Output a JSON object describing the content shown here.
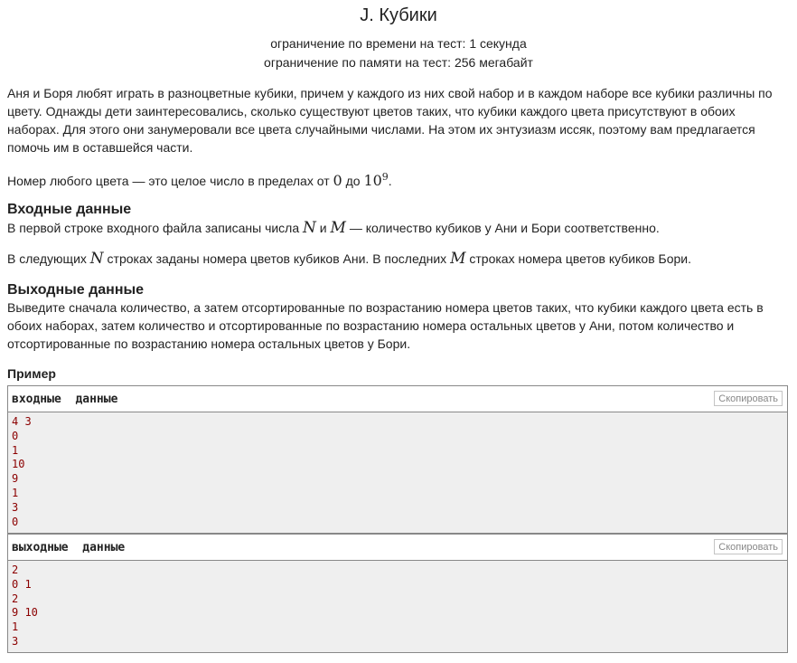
{
  "problem": {
    "title": "J. Кубики",
    "time_limit": "ограничение по времени на тест: 1 секунда",
    "memory_limit": "ограничение по памяти на тест: 256 мегабайт"
  },
  "legend": {
    "text": "Аня и Боря любят играть в разноцветные кубики, причем у каждого из них свой набор и в каждом наборе все кубики различны по цвету. Однажды дети заинтересовались, сколько существуют цветов таких, что кубики каждого цвета присутствуют в обоих наборах. Для этого они занумеровали все цвета случайными числами. На этом их энтузиазм иссяк, поэтому вам предлагается помочь им в оставшейся части.",
    "range_prefix": "Номер любого цвета — это целое число в пределах от ",
    "range_low": "0",
    "range_mid": " до ",
    "range_high_base": "10",
    "range_high_exp": "9",
    "range_suffix": "."
  },
  "input_spec": {
    "title": "Входные данные",
    "p1_prefix": "В первой строке входного файла записаны числа ",
    "var_n": "N",
    "p1_and": " и ",
    "var_m": "M",
    "p1_suffix": " — количество кубиков у Ани и Бори соответственно.",
    "p2_prefix": "В следующих ",
    "p2_middle": " строках заданы номера цветов кубиков Ани. В последних ",
    "p2_suffix": " строках номера цветов кубиков Бори."
  },
  "output_spec": {
    "title": "Выходные данные",
    "text": "Выведите сначала количество, а затем отсортированные по возрастанию номера цветов таких, что кубики каждого цвета есть в обоих наборах, затем количество и отсортированные по возрастанию номера остальных цветов у Ани, потом количество и отсортированные по возрастанию номера остальных цветов у Бори."
  },
  "example": {
    "title": "Пример",
    "input": {
      "header": "входные  данные",
      "copy_label": "Скопировать",
      "lines": [
        "4 3",
        "0",
        "1",
        "10",
        "9",
        "1",
        "3",
        "0"
      ]
    },
    "output": {
      "header": "выходные  данные",
      "copy_label": "Скопировать",
      "lines": [
        "2",
        "0 1",
        "2",
        "9 10",
        "1",
        "3"
      ]
    }
  },
  "colors": {
    "text": "#222222",
    "sample_text": "#8b0000",
    "sample_bg": "#efefef",
    "border": "#888888"
  }
}
